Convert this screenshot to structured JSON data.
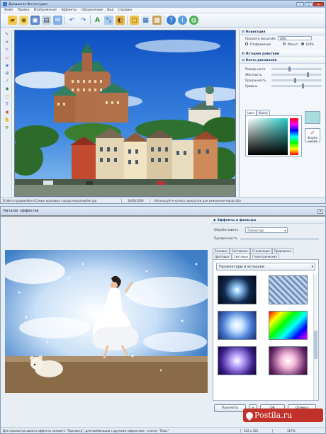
{
  "app": {
    "title": "Домашняя Фотостудия",
    "window_buttons": {
      "minimize": "–",
      "maximize": "□",
      "close": "✕"
    },
    "menu": [
      "Файл",
      "Правка",
      "Изображение",
      "Эффекты",
      "Оформление",
      "Вид",
      "Справка"
    ]
  },
  "toolbar": {
    "icons": [
      "open-folder-icon",
      "gallery-icon",
      "save-icon",
      "print-icon",
      "email-icon",
      "undo-icon",
      "redo-icon",
      "text-icon",
      "resize-icon",
      "color-icon",
      "frame-icon",
      "calendar-icon",
      "collage-icon",
      "help-icon",
      "info-icon",
      "web-icon"
    ]
  },
  "left_tools": [
    "select-tool-icon",
    "crop-tool-icon",
    "brush-tool-icon",
    "eraser-tool-icon",
    "clone-tool-icon",
    "zoom-tool-icon",
    "eyedropper-tool-icon",
    "fill-tool-icon",
    "shape-tool-icon",
    "text-tool-icon",
    "red-eye-tool-icon",
    "hand-tool-icon",
    "rotate-tool-icon"
  ],
  "panel": {
    "navigation": {
      "header": "Навигация",
      "zoom_label": "Просмотр масштаба",
      "zoom_value": "46%",
      "fit_label": "Отображение",
      "fit_value": "Масшт.",
      "zoom100": "100%"
    },
    "history": {
      "header": "История действий"
    },
    "brush": {
      "header": "Кисть рисования",
      "size_label": "Размер кисти",
      "hardness_label": "Жёсткость",
      "transparency_label": "Прозрачность",
      "level_label": "Уровень",
      "size": 0.34,
      "hardness": 0.7,
      "transparency": 0.45,
      "level": 0.6,
      "tab_color": "Цвет",
      "tab_brush": "Кисть",
      "brush_shape": "Форма кисти",
      "current_color": "#a8dde0"
    }
  },
  "status": {
    "path": "D:\\Фотографии\\Фото\\Самые красивые города мира\\квебек.jpg",
    "dimensions": "1600x1000",
    "hint": "Используйте колесо прокрутки для изменения масштаба"
  },
  "catalog": {
    "title": "Каталог эффектов",
    "close": "✕",
    "header": "Эффекты и фильтры",
    "process_label": "Обрабатывать",
    "process_value": "Полностью",
    "transparency_label": "Прозрачность",
    "tabs_row1": [
      "Базовые",
      "Составные",
      "Стилизация",
      "Природные"
    ],
    "tabs_row2": [
      "Цветовые",
      "Световые",
      "Геометрические"
    ],
    "active_tab": "Световые",
    "category": "Прожекторы и вспышки",
    "preview_button": "Просмотр",
    "ok_button": "ОК",
    "cancel_button": "Отмена",
    "status_hint": "Для просмотра одного эффекта нажмите \"Просмотр\", для комбинации с другими эффектами - кнопку \"Плюс\"",
    "status_size": "512 x 355",
    "status_zoom": "117%"
  },
  "watermark": {
    "text": "Postila.ru",
    "color": "#c1312a"
  }
}
